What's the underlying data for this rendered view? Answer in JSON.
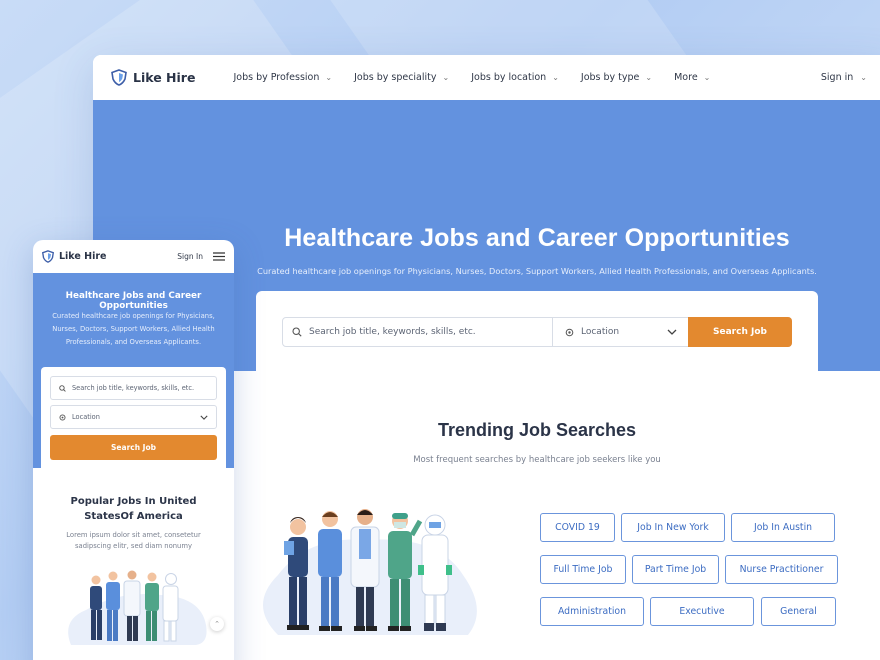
{
  "brand": {
    "name": "Like Hire"
  },
  "desktop": {
    "nav": {
      "items": [
        {
          "label": "Jobs by Profession"
        },
        {
          "label": "Jobs by speciality"
        },
        {
          "label": "Jobs by location"
        },
        {
          "label": "Jobs by type"
        },
        {
          "label": "More"
        }
      ],
      "sign_in": "Sign in"
    },
    "hero": {
      "title": "Healthcare Jobs and Career Opportunities",
      "subtitle": "Curated healthcare job openings for Physicians, Nurses, Doctors, Support Workers, Allied Health Professionals, and Overseas Applicants."
    },
    "search": {
      "placeholder": "Search job title, keywords, skills, etc.",
      "location": "Location",
      "button": "Search Job"
    },
    "trending": {
      "title": "Trending Job Searches",
      "subtitle": "Most frequent searches by healthcare job seekers like you",
      "chips": [
        "COVID 19",
        "Job In New York",
        "Job In Austin",
        "Full Time Job",
        "Part Time Job",
        "Nurse Practitioner",
        "Administration",
        "Executive",
        "General"
      ]
    }
  },
  "mobile": {
    "sign_in": "Sign In",
    "hero": {
      "title": "Healthcare Jobs and Career Opportunities",
      "subtitle": "Curated healthcare job openings for Physicians, Nurses, Doctors, Support Workers, Allied Health Professionals, and Overseas Applicants."
    },
    "search": {
      "placeholder": "Search job title, keywords, skills, etc.",
      "location": "Location",
      "button": "Search Job"
    },
    "popular": {
      "title": "Popular Jobs In United StatesOf America",
      "text": "Lorem ipsum dolor sit amet, consetetur sadipscing elitr, sed diam nonumy"
    }
  },
  "colors": {
    "primary": "#6392df",
    "accent": "#e3892f",
    "chip_border": "#6b95dc",
    "heading": "#2b3448"
  },
  "icons": [
    "shield-logo-icon",
    "chevron-down-icon",
    "user-icon",
    "search-icon",
    "location-pin-icon",
    "hamburger-menu-icon",
    "chevron-up-icon"
  ]
}
